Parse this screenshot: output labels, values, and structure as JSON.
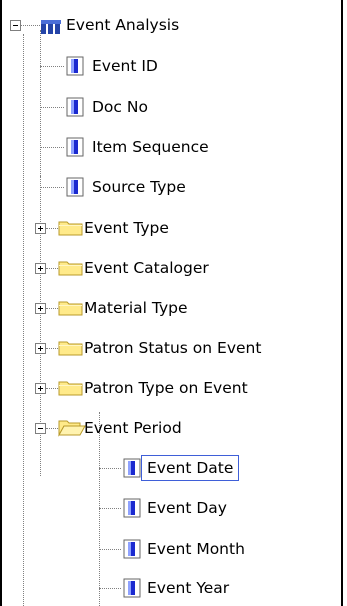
{
  "tree": {
    "root": {
      "label": "Event Analysis",
      "icon": "cube-icon",
      "expanded": true
    },
    "attributes": [
      {
        "label": "Event ID",
        "icon": "attribute-icon"
      },
      {
        "label": "Doc No",
        "icon": "attribute-icon"
      },
      {
        "label": "Item Sequence",
        "icon": "attribute-icon"
      },
      {
        "label": "Source Type",
        "icon": "attribute-icon"
      }
    ],
    "folders": [
      {
        "label": "Event Type",
        "icon": "folder-closed-icon",
        "expanded": false
      },
      {
        "label": "Event Cataloger",
        "icon": "folder-closed-icon",
        "expanded": false
      },
      {
        "label": "Material Type",
        "icon": "folder-closed-icon",
        "expanded": false
      },
      {
        "label": "Patron Status on Event",
        "icon": "folder-closed-icon",
        "expanded": false
      },
      {
        "label": "Patron Type on Event",
        "icon": "folder-closed-icon",
        "expanded": false
      }
    ],
    "open_folder": {
      "label": "Event Period",
      "icon": "folder-open-icon",
      "expanded": true
    },
    "period_items": [
      {
        "label": "Event Date",
        "icon": "attribute-icon",
        "selected": true
      },
      {
        "label": "Event Day",
        "icon": "attribute-icon",
        "selected": false
      },
      {
        "label": "Event Month",
        "icon": "attribute-icon",
        "selected": false
      },
      {
        "label": "Event Year",
        "icon": "attribute-icon",
        "selected": false
      }
    ]
  },
  "colors": {
    "folder_fill": "#ffea8a",
    "folder_stroke": "#b89a2a",
    "attribute_blue": "#1b2ad0",
    "cube_blue": "#2444a8",
    "selection_border": "#3f5fd8"
  }
}
